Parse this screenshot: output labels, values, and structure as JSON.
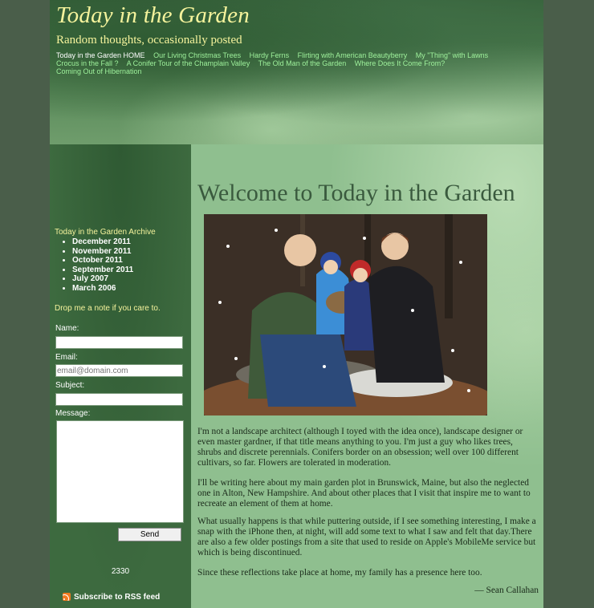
{
  "header": {
    "title": "Today in the Garden",
    "tagline": "Random thoughts, occasionally posted",
    "nav": [
      {
        "label": "Today in the Garden HOME"
      },
      {
        "label": "Our Living Christmas Trees"
      },
      {
        "label": "Hardy Ferns"
      },
      {
        "label": "Flirting with American Beautyberry"
      },
      {
        "label": "My \"Thing\" with Lawns"
      },
      {
        "label": "Crocus in the Fall ?"
      },
      {
        "label": "A Conifer Tour of the Champlain Valley"
      },
      {
        "label": "The Old Man of the Garden"
      },
      {
        "label": "Where Does It Come From?"
      },
      {
        "label": "Coming Out of Hibernation"
      }
    ]
  },
  "sidebar": {
    "archive_title": "Today in the Garden Archive",
    "archive": [
      "December 2011",
      "November 2011",
      "October 2011",
      "September 2011",
      "July 2007",
      "March 2006"
    ],
    "drop_note": "Drop me a note if you care to.",
    "form": {
      "name_label": "Name:",
      "email_label": "Email:",
      "email_placeholder": "email@domain.com",
      "subject_label": "Subject:",
      "message_label": "Message:",
      "send_label": "Send"
    },
    "counter": "2330",
    "rss_label": "Subscribe to RSS feed"
  },
  "main": {
    "title": "Welcome to Today in the Garden",
    "paragraphs": [
      "I'm not a landscape architect (although I toyed with the idea once), landscape designer or even master gardner, if that title means anything to you. I'm just a guy who likes trees, shrubs and discrete perennials. Conifers border on an obsession; well over 100 different cultivars, so far. Flowers are tolerated in moderation.",
      "I'll be writing here about my main garden plot in Brunswick, Maine, but also the neglected one in Alton, New Hampshire. And about other places that I visit that inspire me to want to recreate an element of them at home.",
      "What usually happens is that while puttering outside, if I see something interesting, I make a snap with the iPhone then, at night, will add some text to what I saw and felt that day.There are also a few older postings from a site that used to reside on Apple's MobileMe service but which is being discontinued.",
      "Since these reflections take place at home, my family has a presence here too."
    ],
    "signature": "— Sean Callahan"
  }
}
